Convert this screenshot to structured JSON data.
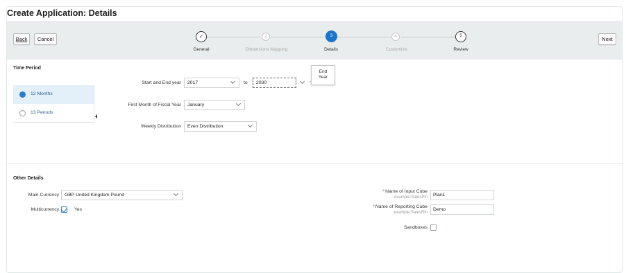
{
  "page_title": "Create Application: Details",
  "toolbar": {
    "back_label": "Back",
    "cancel_label": "Cancel",
    "next_label": "Next"
  },
  "train": {
    "steps": [
      {
        "number": "✓",
        "label": "General",
        "state": "done"
      },
      {
        "number": "2",
        "label": "Dimensions Mapping",
        "state": "disabled"
      },
      {
        "number": "3",
        "label": "Details",
        "state": "current"
      },
      {
        "number": "4",
        "label": "Customize",
        "state": "disabled"
      },
      {
        "number": "5",
        "label": "Review",
        "state": "todo"
      }
    ]
  },
  "time_period": {
    "title": "Time Period",
    "options": [
      {
        "label": "12 Months",
        "selected": true
      },
      {
        "label": "13 Periods",
        "selected": false
      }
    ],
    "start_end_label": "Start and End year",
    "start_year": "2017",
    "to_label": "to",
    "end_year": "2030",
    "end_year_tooltip": [
      "End",
      "Year"
    ],
    "first_month_label": "First Month of Fiscal Year",
    "first_month": "January",
    "weekly_dist_label": "Weekly Distribution",
    "weekly_dist": "Even Distribution"
  },
  "other_details": {
    "title": "Other Details",
    "main_currency_label": "Main Currency",
    "main_currency": "GBP United Kingdom Pound",
    "multicurrency_label": "Multicurrency",
    "multicurrency_checked": true,
    "multicurrency_value_label": "Yes",
    "input_cube_label": "Name of Input Cube",
    "input_cube_hint": "example:SalesPln",
    "input_cube_value": "Plan1",
    "reporting_cube_label": "Name of Reporting Cube",
    "reporting_cube_hint": "example:SalesRln",
    "reporting_cube_value": "Demo",
    "sandboxes_label": "Sandboxes",
    "sandboxes_checked": false
  },
  "colors": {
    "accent": "#1a76c9",
    "train_bg": "#eaeded",
    "selected_row": "#e3eff9",
    "required": "#c01f2b"
  }
}
